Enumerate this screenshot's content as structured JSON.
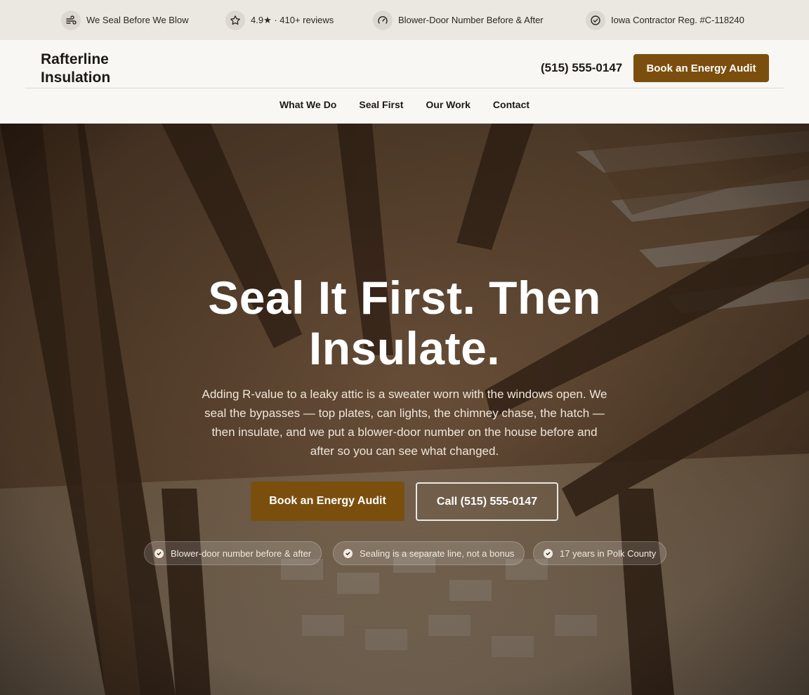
{
  "topbar": {
    "items": [
      {
        "label": "We Seal Before We Blow",
        "icon": "wind-icon"
      },
      {
        "label": "4.9★ · 410+ reviews",
        "icon": "star-icon"
      },
      {
        "label": "Blower-Door Number Before & After",
        "icon": "gauge-icon"
      },
      {
        "label": "Iowa Contractor Reg. #C-118240",
        "icon": "check-circle-icon"
      }
    ]
  },
  "header": {
    "logo": "Rafterline Insulation",
    "phone": "(515) 555-0147",
    "cta": "Book an Energy Audit",
    "nav": [
      "What We Do",
      "Seal First",
      "Our Work",
      "Contact"
    ]
  },
  "hero": {
    "title": "Seal It First. Then Insulate.",
    "subtitle": "Adding R-value to a leaky attic is a sweater worn with the windows open. We seal the bypasses — top plates, can lights, the chimney chase, the hatch — then insulate, and we put a blower-door number on the house before and after so you can see what changed.",
    "primary_cta": "Book an Energy Audit",
    "secondary_cta": "Call (515) 555-0147",
    "badges": [
      "Blower-door number before & after",
      "Sealing is a separate line, not a bonus",
      "17 years in Polk County"
    ]
  },
  "colors": {
    "accent": "#7a4f0e",
    "topbar_bg": "#ebe8e1",
    "header_bg": "#f8f7f3"
  }
}
